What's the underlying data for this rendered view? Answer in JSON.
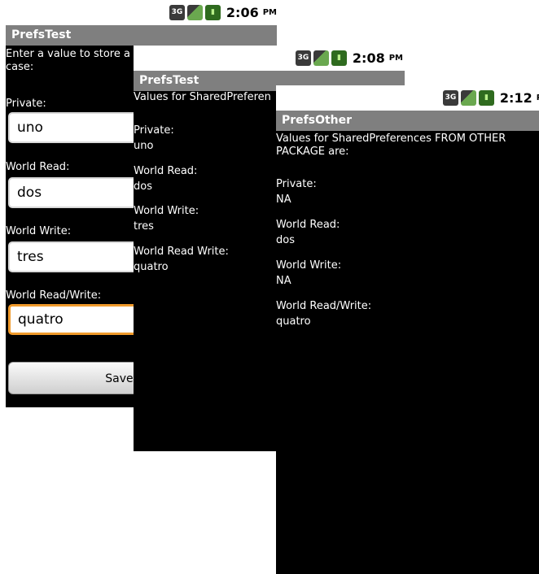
{
  "screen1": {
    "status": {
      "time": "2:06",
      "ampm": "PM",
      "network": "3G"
    },
    "title": "PrefsTest",
    "intro": "Enter a value to store a\ncase:",
    "private_label": "Private:",
    "private_value": "uno",
    "world_read_label": "World Read:",
    "world_read_value": "dos",
    "world_write_label": "World Write:",
    "world_write_value": "tres",
    "world_read_write_label": "World Read/Write:",
    "world_read_write_value": "quatro",
    "save_label": "Save p"
  },
  "screen2": {
    "status": {
      "time": "2:08",
      "ampm": "PM",
      "network": "3G"
    },
    "title": "PrefsTest",
    "intro": "Values for SharedPreferen",
    "private_label": "Private:",
    "private_value": "uno",
    "world_read_label": "World Read:",
    "world_read_value": "dos",
    "world_write_label": "World Write:",
    "world_write_value": "tres",
    "world_read_write_label": "World Read Write:",
    "world_read_write_value": "quatro"
  },
  "screen3": {
    "status": {
      "time": "2:12",
      "ampm": "PM",
      "network": "3G"
    },
    "title": "PrefsOther",
    "intro": "Values for SharedPreferences FROM OTHER\nPACKAGE are:",
    "private_label": "Private:",
    "private_value": "NA",
    "world_read_label": "World Read:",
    "world_read_value": "dos",
    "world_write_label": "World Write:",
    "world_write_value": "NA",
    "world_read_write_label": "World Read/Write:",
    "world_read_write_value": "quatro"
  }
}
